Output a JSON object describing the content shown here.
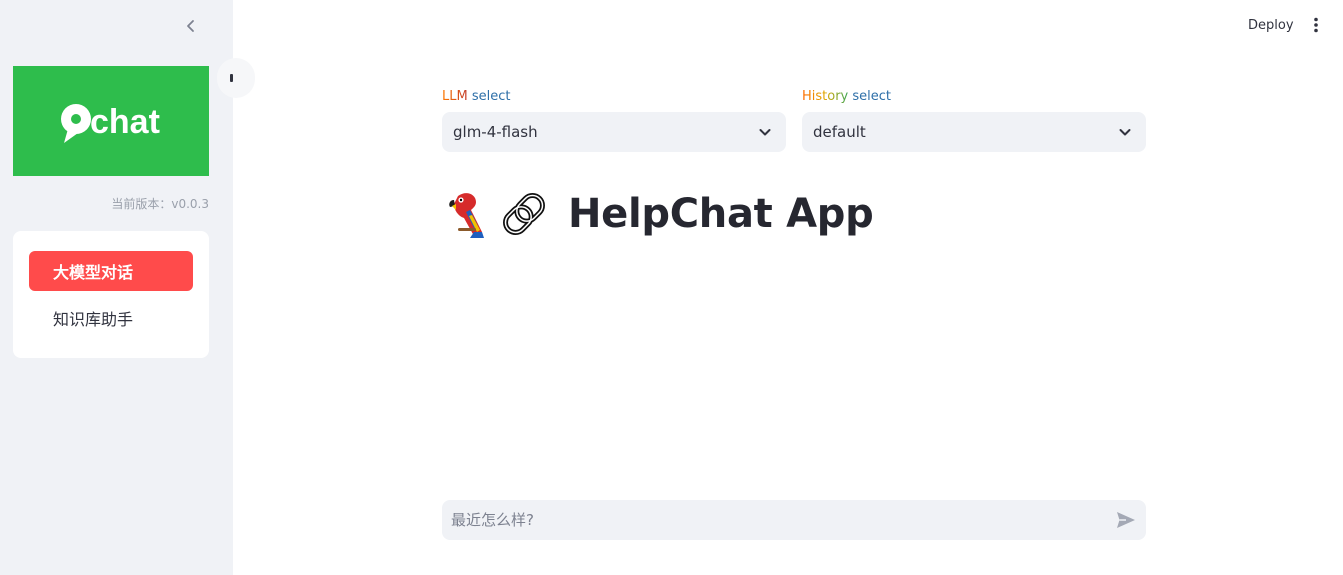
{
  "sidebar": {
    "logo_text": "chat",
    "version_label": "当前版本：v0.0.3",
    "menu": [
      {
        "label": "大模型对话",
        "active": true
      },
      {
        "label": "知识库助手",
        "active": false
      }
    ]
  },
  "header": {
    "deploy_label": "Deploy"
  },
  "main": {
    "llm_select": {
      "label_part1": "LLM",
      "label_part2": "select",
      "value": "glm-4-flash"
    },
    "history_select": {
      "label_part1": "History",
      "label_part2": "select",
      "value": "default"
    },
    "title": "HelpChat App",
    "title_emojis": [
      "parrot-emoji",
      "link-emoji"
    ],
    "chat": {
      "placeholder": "最近怎么样?"
    }
  },
  "colors": {
    "accent": "#ff4b4b",
    "sidebar_bg": "#f0f2f6",
    "logo_green": "#2ebd4c"
  }
}
